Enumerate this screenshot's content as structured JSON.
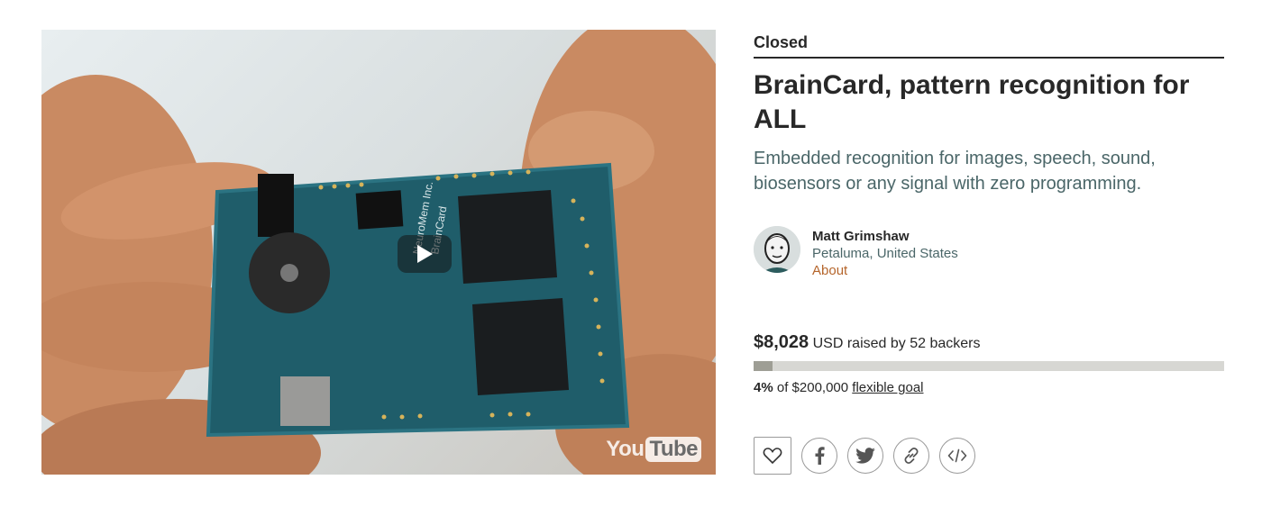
{
  "video": {
    "board_line1": "NeuroMem Inc.",
    "board_line2": "BrainCard",
    "provider_you": "You",
    "provider_tube": "Tube"
  },
  "project": {
    "status": "Closed",
    "title": "BrainCard, pattern recognition for ALL",
    "blurb": "Embedded recognition for images, speech, sound, biosensors or any signal with zero programming."
  },
  "creator": {
    "name": "Matt Grimshaw",
    "location": "Petaluma, United States",
    "about_label": "About"
  },
  "funding": {
    "amount": "$8,028",
    "raised_text": "USD raised by 52 backers",
    "percent": "4%",
    "goal_text": "of $200,000",
    "goal_type_label": "flexible goal",
    "progress_fraction": 0.04
  },
  "share": {
    "icons": [
      "heart-icon",
      "facebook-icon",
      "twitter-icon",
      "link-icon",
      "embed-icon"
    ]
  }
}
